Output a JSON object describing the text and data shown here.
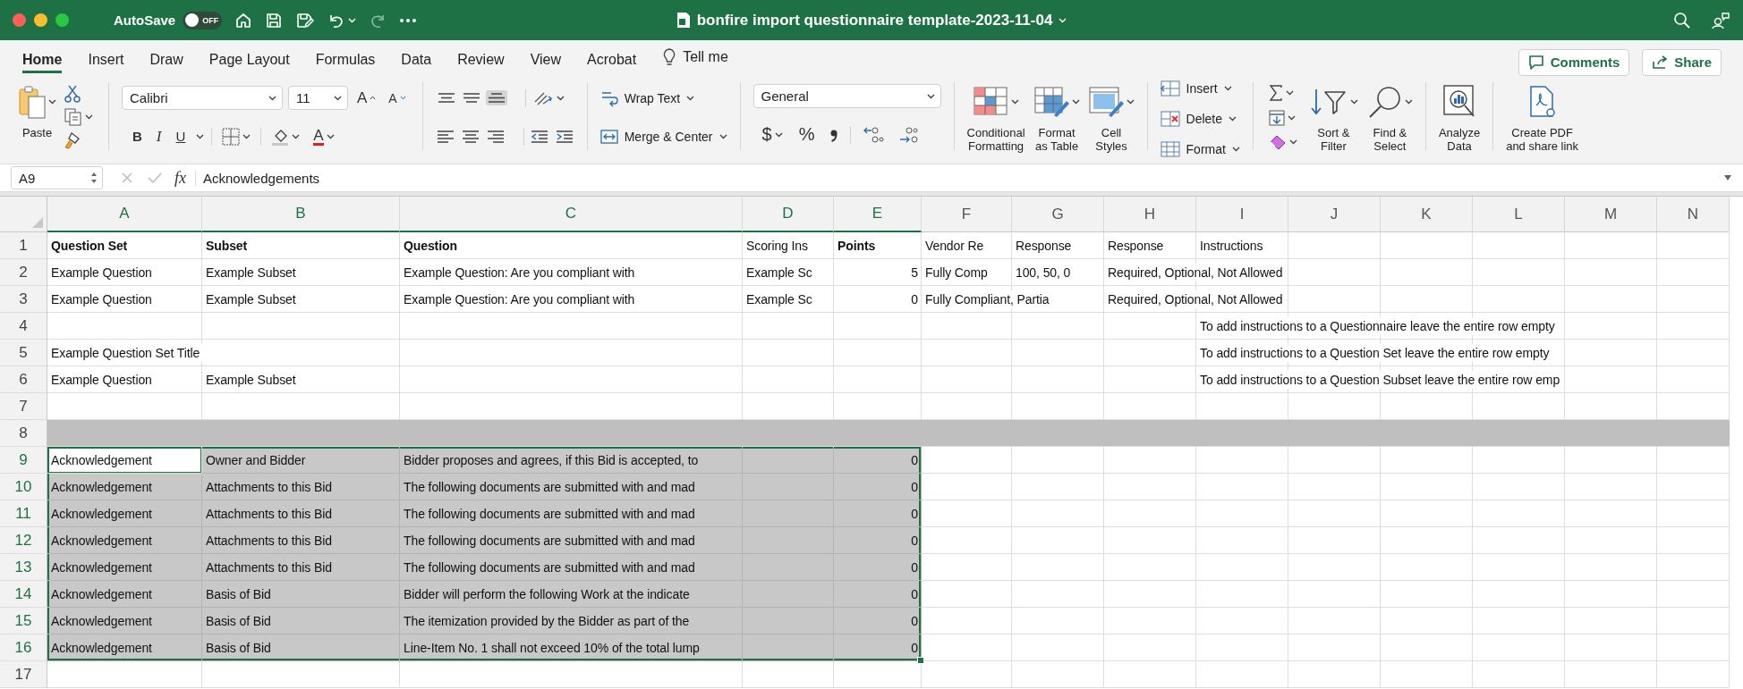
{
  "window": {
    "title": "bonfire import questionnaire template-2023-11-04"
  },
  "autosave": {
    "label": "AutoSave",
    "on": false,
    "state_label": "OFF"
  },
  "tabs": [
    {
      "label": "Home",
      "selected": true
    },
    {
      "label": "Insert",
      "selected": false
    },
    {
      "label": "Draw",
      "selected": false
    },
    {
      "label": "Page Layout",
      "selected": false
    },
    {
      "label": "Formulas",
      "selected": false
    },
    {
      "label": "Data",
      "selected": false
    },
    {
      "label": "Review",
      "selected": false
    },
    {
      "label": "View",
      "selected": false
    },
    {
      "label": "Acrobat",
      "selected": false
    }
  ],
  "tell_me": "Tell me",
  "actions": [
    {
      "label": "Comments",
      "kind": "comment"
    },
    {
      "label": "Share",
      "kind": "share"
    }
  ],
  "ribbon": {
    "paste": "Paste",
    "font": {
      "name": "Calibri",
      "size": "11",
      "styles": [
        "B",
        "I",
        "U"
      ],
      "grow": "A",
      "shrink": "A",
      "font_color_label": "A"
    },
    "vertical_align": [
      {
        "kind": "top",
        "selected": false
      },
      {
        "kind": "middle",
        "selected": false
      },
      {
        "kind": "bottom",
        "selected": true
      }
    ],
    "wrap": "Wrap Text",
    "merge": "Merge & Center",
    "number": {
      "format": "General",
      "currency": "$",
      "percent": "%"
    },
    "styles": [
      {
        "label": "Conditional\nFormatting",
        "kind": "conditional"
      },
      {
        "label": "Format\nas Table",
        "kind": "table"
      },
      {
        "label": "Cell\nStyles",
        "kind": "styles"
      }
    ],
    "cells": [
      {
        "label": "Insert",
        "kind": "insert"
      },
      {
        "label": "Delete",
        "kind": "delete"
      },
      {
        "label": "Format",
        "kind": "format"
      }
    ],
    "editing": [
      {
        "label": "Sort &\nFilter",
        "kind": "sort"
      },
      {
        "label": "Find &\nSelect",
        "kind": "find"
      }
    ],
    "analyze": "Analyze\nData",
    "pdf": "Create PDF\nand share link"
  },
  "formula_bar": {
    "name_box": "A9",
    "fx_label": "fx",
    "formula": "Acknowledgements"
  },
  "sheet": {
    "columns": [
      {
        "label": "A",
        "selected": true
      },
      {
        "label": "B",
        "selected": true
      },
      {
        "label": "C",
        "selected": true
      },
      {
        "label": "D",
        "selected": true
      },
      {
        "label": "E",
        "selected": true
      },
      {
        "label": "F",
        "selected": false
      },
      {
        "label": "G",
        "selected": false
      },
      {
        "label": "H",
        "selected": false
      },
      {
        "label": "I",
        "selected": false
      },
      {
        "label": "J",
        "selected": false
      },
      {
        "label": "K",
        "selected": false
      },
      {
        "label": "L",
        "selected": false
      },
      {
        "label": "M",
        "selected": false
      },
      {
        "label": "N",
        "selected": false
      }
    ],
    "rows": [
      {
        "label": "1",
        "selected": false,
        "shaded": false,
        "cells": [
          {
            "text": "Question Set",
            "kind": "text",
            "bold": true,
            "active": false
          },
          {
            "text": "Subset",
            "kind": "text",
            "bold": true,
            "active": false
          },
          {
            "text": "Question",
            "kind": "text",
            "bold": true,
            "active": false
          },
          {
            "text": "Scoring Ins",
            "kind": "text",
            "bold": false,
            "active": false
          },
          {
            "text": "Points",
            "kind": "text",
            "bold": true,
            "active": false
          },
          {
            "text": "Vendor Re",
            "kind": "text",
            "bold": false,
            "active": false
          },
          {
            "text": "Response",
            "kind": "text",
            "bold": false,
            "active": false
          },
          {
            "text": "Response",
            "kind": "text",
            "bold": false,
            "active": false
          },
          {
            "text": "Instructions",
            "kind": "text",
            "bold": false,
            "active": false
          }
        ]
      },
      {
        "label": "2",
        "selected": false,
        "shaded": false,
        "cells": [
          {
            "text": "Example Question",
            "kind": "text",
            "bold": false,
            "active": false
          },
          {
            "text": "Example Subset",
            "kind": "text",
            "bold": false,
            "active": false
          },
          {
            "text": "Example Question: Are you compliant with",
            "kind": "text",
            "bold": false,
            "active": false
          },
          {
            "text": "Example Sc",
            "kind": "text",
            "bold": false,
            "active": false
          },
          {
            "text": "5",
            "kind": "number",
            "bold": false,
            "active": false
          },
          {
            "text": "Fully Comp",
            "kind": "text",
            "bold": false,
            "active": false
          },
          {
            "text": "100, 50, 0",
            "kind": "text",
            "bold": false,
            "active": false
          },
          {
            "text": "Required, Optional, Not Allowed",
            "kind": "text",
            "bold": false,
            "active": false
          }
        ]
      },
      {
        "label": "3",
        "selected": false,
        "shaded": false,
        "cells": [
          {
            "text": "Example Question",
            "kind": "text",
            "bold": false,
            "active": false
          },
          {
            "text": "Example Subset",
            "kind": "text",
            "bold": false,
            "active": false
          },
          {
            "text": "Example Question: Are you compliant with",
            "kind": "text",
            "bold": false,
            "active": false
          },
          {
            "text": "Example Sc",
            "kind": "text",
            "bold": false,
            "active": false
          },
          {
            "text": "0",
            "kind": "number",
            "bold": false,
            "active": false
          },
          {
            "text": "Fully Compliant, Partia",
            "kind": "text",
            "bold": false,
            "active": false
          },
          {
            "kind": "empty"
          },
          {
            "text": "Required, Optional, Not Allowed",
            "kind": "text",
            "bold": false,
            "active": false
          }
        ]
      },
      {
        "label": "4",
        "selected": false,
        "shaded": false,
        "cells": [
          {
            "kind": "empty"
          },
          {
            "kind": "empty"
          },
          {
            "kind": "empty"
          },
          {
            "kind": "empty"
          },
          {
            "kind": "empty"
          },
          {
            "kind": "empty"
          },
          {
            "kind": "empty"
          },
          {
            "kind": "empty"
          },
          {
            "text": "To add instructions to a Questionnaire leave the entire row empty",
            "kind": "text",
            "bold": false,
            "active": false
          }
        ]
      },
      {
        "label": "5",
        "selected": false,
        "shaded": false,
        "cells": [
          {
            "text": "Example Question Set Title",
            "kind": "text",
            "bold": false,
            "active": false
          },
          {
            "kind": "empty"
          },
          {
            "kind": "empty"
          },
          {
            "kind": "empty"
          },
          {
            "kind": "empty"
          },
          {
            "kind": "empty"
          },
          {
            "kind": "empty"
          },
          {
            "kind": "empty"
          },
          {
            "text": "To add instructions to a Question Set leave the entire row empty",
            "kind": "text",
            "bold": false,
            "active": false
          }
        ]
      },
      {
        "label": "6",
        "selected": false,
        "shaded": false,
        "cells": [
          {
            "text": "Example Question",
            "kind": "text",
            "bold": false,
            "active": false
          },
          {
            "text": "Example Subset",
            "kind": "text",
            "bold": false,
            "active": false
          },
          {
            "kind": "empty"
          },
          {
            "kind": "empty"
          },
          {
            "kind": "empty"
          },
          {
            "kind": "empty"
          },
          {
            "kind": "empty"
          },
          {
            "kind": "empty"
          },
          {
            "text": "To add instructions to a Question Subset leave the entire row emp",
            "kind": "text",
            "bold": false,
            "active": false
          }
        ]
      },
      {
        "label": "7",
        "selected": false,
        "shaded": false
      },
      {
        "label": "8",
        "selected": false,
        "shaded": true
      },
      {
        "label": "9",
        "selected": true,
        "shaded": false,
        "cells": [
          {
            "text": "Acknowledgement",
            "kind": "text",
            "bold": false,
            "active": true
          },
          {
            "text": "Owner and Bidder",
            "kind": "text",
            "bold": false,
            "active": false
          },
          {
            "text": "Bidder proposes and agrees, if this Bid is accepted, to",
            "kind": "text",
            "bold": false,
            "active": false
          },
          {
            "kind": "empty"
          },
          {
            "text": "0",
            "kind": "number",
            "bold": false,
            "active": false
          }
        ]
      },
      {
        "label": "10",
        "selected": true,
        "shaded": false,
        "cells": [
          {
            "text": "Acknowledgement",
            "kind": "text",
            "bold": false,
            "active": false
          },
          {
            "text": "Attachments to this Bid",
            "kind": "text",
            "bold": false,
            "active": false
          },
          {
            "text": "The following documents are submitted with and mad",
            "kind": "text",
            "bold": false,
            "active": false
          },
          {
            "kind": "empty"
          },
          {
            "text": "0",
            "kind": "number",
            "bold": false,
            "active": false
          }
        ]
      },
      {
        "label": "11",
        "selected": true,
        "shaded": false,
        "cells": [
          {
            "text": "Acknowledgement",
            "kind": "text",
            "bold": false,
            "active": false
          },
          {
            "text": "Attachments to this Bid",
            "kind": "text",
            "bold": false,
            "active": false
          },
          {
            "text": "The following documents are submitted with and mad",
            "kind": "text",
            "bold": false,
            "active": false
          },
          {
            "kind": "empty"
          },
          {
            "text": "0",
            "kind": "number",
            "bold": false,
            "active": false
          }
        ]
      },
      {
        "label": "12",
        "selected": true,
        "shaded": false,
        "cells": [
          {
            "text": "Acknowledgement",
            "kind": "text",
            "bold": false,
            "active": false
          },
          {
            "text": "Attachments to this Bid",
            "kind": "text",
            "bold": false,
            "active": false
          },
          {
            "text": "The following documents are submitted with and mad",
            "kind": "text",
            "bold": false,
            "active": false
          },
          {
            "kind": "empty"
          },
          {
            "text": "0",
            "kind": "number",
            "bold": false,
            "active": false
          }
        ]
      },
      {
        "label": "13",
        "selected": true,
        "shaded": false,
        "cells": [
          {
            "text": "Acknowledgement",
            "kind": "text",
            "bold": false,
            "active": false
          },
          {
            "text": "Attachments to this Bid",
            "kind": "text",
            "bold": false,
            "active": false
          },
          {
            "text": "The following documents are submitted with and mad",
            "kind": "text",
            "bold": false,
            "active": false
          },
          {
            "kind": "empty"
          },
          {
            "text": "0",
            "kind": "number",
            "bold": false,
            "active": false
          }
        ]
      },
      {
        "label": "14",
        "selected": true,
        "shaded": false,
        "cells": [
          {
            "text": "Acknowledgement",
            "kind": "text",
            "bold": false,
            "active": false
          },
          {
            "text": "Basis of Bid",
            "kind": "text",
            "bold": false,
            "active": false
          },
          {
            "text": "Bidder will perform the following Work at the indicate",
            "kind": "text",
            "bold": false,
            "active": false
          },
          {
            "kind": "empty"
          },
          {
            "text": "0",
            "kind": "number",
            "bold": false,
            "active": false
          }
        ]
      },
      {
        "label": "15",
        "selected": true,
        "shaded": false,
        "cells": [
          {
            "text": "Acknowledgement",
            "kind": "text",
            "bold": false,
            "active": false
          },
          {
            "text": "Basis of Bid",
            "kind": "text",
            "bold": false,
            "active": false
          },
          {
            "text": "The itemization provided by the Bidder as part of the",
            "kind": "text",
            "bold": false,
            "active": false
          },
          {
            "kind": "empty"
          },
          {
            "text": "0",
            "kind": "number",
            "bold": false,
            "active": false
          }
        ]
      },
      {
        "label": "16",
        "selected": true,
        "shaded": false,
        "cells": [
          {
            "text": "Acknowledgement",
            "kind": "text",
            "bold": false,
            "active": false
          },
          {
            "text": "Basis of Bid",
            "kind": "text",
            "bold": false,
            "active": false
          },
          {
            "text": "Line-Item No. 1 shall not exceed 10% of the total lump",
            "kind": "text",
            "bold": false,
            "active": false
          },
          {
            "kind": "empty"
          },
          {
            "text": "0",
            "kind": "number",
            "bold": false,
            "active": false
          }
        ]
      },
      {
        "label": "17",
        "selected": false,
        "shaded": false
      }
    ]
  }
}
